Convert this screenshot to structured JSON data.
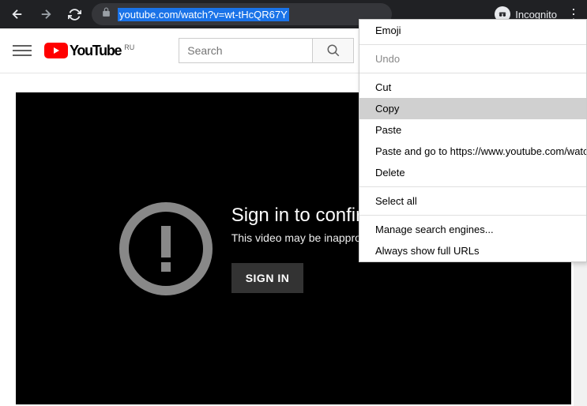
{
  "browser": {
    "url": "youtube.com/watch?v=wt-tHcQR67Y",
    "incognito_label": "Incognito"
  },
  "youtube": {
    "brand": "YouTube",
    "region": "RU",
    "search_placeholder": "Search"
  },
  "player": {
    "title": "Sign in to confirm your age",
    "subtitle": "This video may be inappropriate for some users.",
    "button": "SIGN IN"
  },
  "context_menu": {
    "emoji": "Emoji",
    "undo": "Undo",
    "cut": "Cut",
    "copy": "Copy",
    "paste": "Paste",
    "paste_go": "Paste and go to https://www.youtube.com/watch?v",
    "delete": "Delete",
    "select_all": "Select all",
    "manage_search": "Manage search engines...",
    "show_urls": "Always show full URLs"
  }
}
